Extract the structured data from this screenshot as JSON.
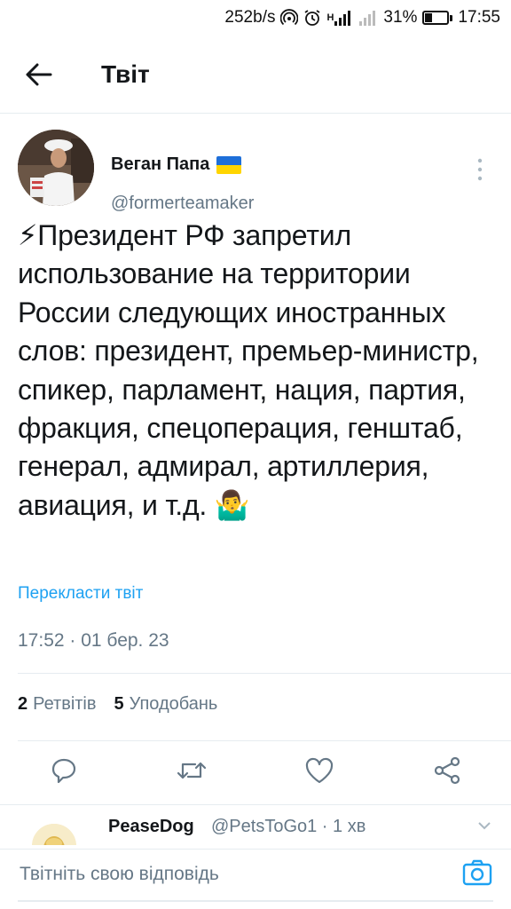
{
  "status_bar": {
    "network_speed": "252b/s",
    "signal_label": "H",
    "battery_percent": "31%",
    "battery_level": 0.31,
    "time": "17:55"
  },
  "header": {
    "title": "Твіт",
    "back_icon": "arrow-left-icon"
  },
  "tweet": {
    "author_name": "Веган Папа",
    "author_handle": "@formerteamaker",
    "text": "⚡Президент РФ запретил использование на территории России следующих иностранных слов: президент, премьер-министр, спикер, парламент, нация, партия, фракция, спецоперация, генштаб, генерал, адмирал, артиллерия, авиация, и т.д. 🤷‍♂",
    "translate_label": "Перекласти твіт",
    "timestamp": "17:52 · 01 бер. 23"
  },
  "stats": {
    "retweets_count": "2",
    "retweets_label": "Ретвітів",
    "likes_count": "5",
    "likes_label": "Уподобань"
  },
  "actions": [
    "reply-icon",
    "retweet-icon",
    "like-icon",
    "share-icon"
  ],
  "reply_preview": {
    "name": "PeaseDog",
    "meta": "@PetsToGo1 · 1 хв"
  },
  "composer": {
    "placeholder": "Твітніть свою відповідь"
  },
  "colors": {
    "accent": "#1da1f2",
    "text": "#14171a",
    "secondary": "#657786",
    "divider": "#e6ecf0"
  }
}
